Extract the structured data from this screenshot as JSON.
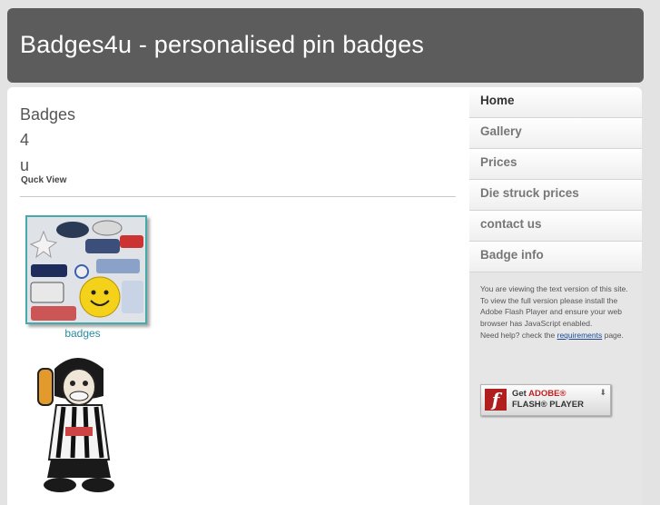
{
  "header": {
    "title": "Badges4u - personalised pin badges"
  },
  "main": {
    "heading_lines": [
      "Badges",
      "4",
      "u"
    ],
    "quick_view": "Quck View",
    "thumb_caption": "badges"
  },
  "sidebar": {
    "nav": [
      {
        "label": "Home",
        "active": true
      },
      {
        "label": "Gallery"
      },
      {
        "label": "Prices"
      },
      {
        "label": "Die struck prices"
      },
      {
        "label": "contact us"
      },
      {
        "label": "Badge info"
      }
    ],
    "note": {
      "line1": "You are viewing the text version of this site.",
      "line2": "To view the full version please install the Adobe Flash Player and ensure your web browser has JavaScript enabled.",
      "help_prefix": "Need help? check the",
      "help_link": "requirements",
      "help_suffix": "page."
    },
    "flash_button": {
      "get": "Get",
      "adobe": "ADOBE®",
      "product": "FLASH® PLAYER"
    }
  }
}
